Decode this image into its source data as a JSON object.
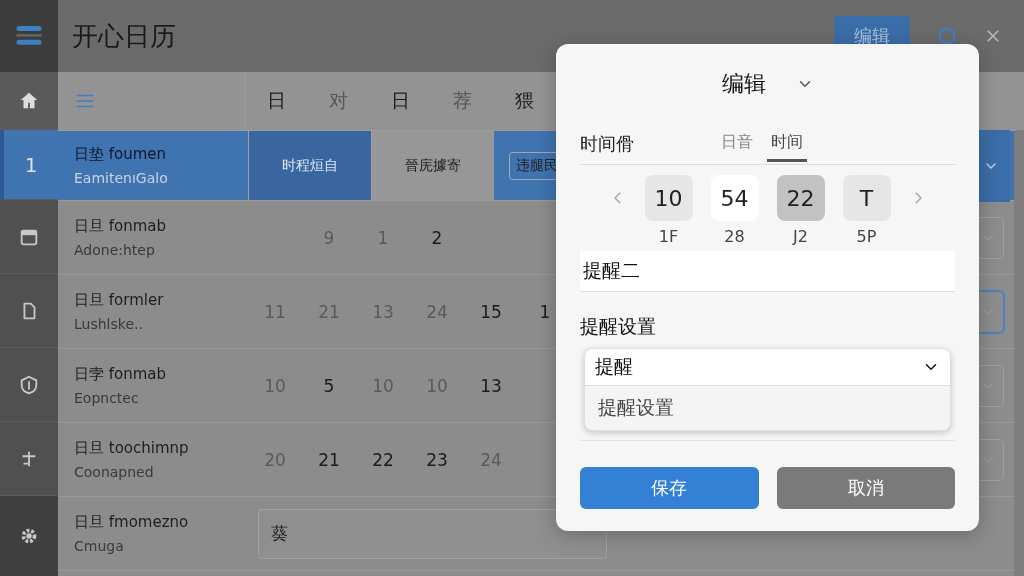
{
  "app": {
    "title": "开心日历",
    "top_button": "编辑"
  },
  "rail": [
    {
      "selected": false
    },
    {
      "label": "1",
      "selected": true
    },
    {
      "selected": false
    },
    {
      "selected": false
    },
    {
      "selected": false
    },
    {
      "selected": false
    },
    {
      "selected": false
    }
  ],
  "columns": [
    "日",
    "对",
    "日",
    "荐",
    "猥"
  ],
  "rows": [
    {
      "name": "日垫 foumen",
      "sub": "EamitenıGalo",
      "selected": true,
      "dropdown": {
        "focused": false
      },
      "cells": [
        {
          "kind": "tag",
          "text": "时程烜自"
        },
        {
          "kind": "text",
          "text": "晉庑據寄"
        },
        {
          "kind": "box",
          "text": "违腿民"
        }
      ]
    },
    {
      "name": "日旦 fonmab",
      "sub": "Adone:htep",
      "selected": false,
      "dropdown": {
        "focused": false
      },
      "cells": [
        {
          "kind": "blank"
        },
        {
          "kind": "number",
          "text": "9",
          "faint": true
        },
        {
          "kind": "number",
          "text": "1",
          "faint": true
        },
        {
          "kind": "number",
          "text": "2",
          "faint": false
        }
      ]
    },
    {
      "name": "日旦 formler",
      "sub": "Lushlske..",
      "selected": false,
      "dropdown": {
        "focused": true
      },
      "cells": [
        {
          "kind": "number",
          "text": "11",
          "faint": true
        },
        {
          "kind": "number",
          "text": "21",
          "faint": true
        },
        {
          "kind": "number",
          "text": "13",
          "faint": true
        },
        {
          "kind": "number",
          "text": "24",
          "faint": true
        },
        {
          "kind": "number",
          "text": "15",
          "faint": false
        },
        {
          "kind": "number",
          "text": "1",
          "faint": false
        }
      ]
    },
    {
      "name": "日孛 fonmab",
      "sub": "Eopnctec",
      "selected": false,
      "dropdown": {
        "focused": false
      },
      "cells": [
        {
          "kind": "number",
          "text": "10",
          "faint": true
        },
        {
          "kind": "number",
          "text": "5",
          "faint": false
        },
        {
          "kind": "number",
          "text": "10",
          "faint": true
        },
        {
          "kind": "number",
          "text": "10",
          "faint": true
        },
        {
          "kind": "number",
          "text": "13",
          "faint": false
        }
      ]
    },
    {
      "name": "日旦 toochimnp",
      "sub": "Coonapned",
      "selected": false,
      "dropdown": {
        "focused": false
      },
      "cells": [
        {
          "kind": "number",
          "text": "20",
          "faint": true
        },
        {
          "kind": "number",
          "text": "21",
          "faint": false
        },
        {
          "kind": "number",
          "text": "22",
          "faint": false
        },
        {
          "kind": "number",
          "text": "23",
          "faint": false
        },
        {
          "kind": "number",
          "text": "24",
          "faint": true
        }
      ]
    },
    {
      "name": "日旦 fmomezno",
      "sub": "Cmuga",
      "selected": false,
      "cells": [
        {
          "kind": "input",
          "value": "葵"
        }
      ]
    }
  ],
  "dialog": {
    "title": "编辑",
    "section_label": "时间傦",
    "tabs": [
      {
        "label": "日音",
        "selected": false
      },
      {
        "label": "时间",
        "selected": true
      }
    ],
    "picker": [
      {
        "value": "10",
        "sub": "1F",
        "selected": false,
        "focused": false
      },
      {
        "value": "54",
        "sub": "28",
        "selected": false,
        "focused": true
      },
      {
        "value": "22",
        "sub": "J2",
        "selected": true,
        "focused": false
      },
      {
        "value": "T",
        "sub": "5P",
        "selected": false,
        "focused": false
      }
    ],
    "name_value": "提醒二",
    "reminder_label": "提醒设置",
    "select": {
      "value": "提醒",
      "expanded": true,
      "options": [
        "提醒设置"
      ]
    },
    "buttons": [
      {
        "label": "保存",
        "kind": "primary"
      },
      {
        "label": "取消",
        "kind": "secondary"
      }
    ]
  }
}
